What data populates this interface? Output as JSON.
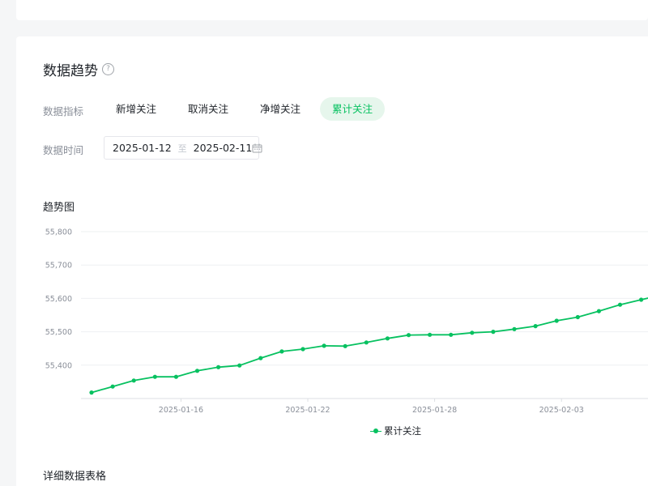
{
  "section": {
    "title": "数据趋势",
    "help_icon": "question-circle-icon"
  },
  "filters": {
    "metric_label": "数据指标",
    "metric_tabs": [
      "新增关注",
      "取消关注",
      "净增关注",
      "累计关注"
    ],
    "active_metric": "累计关注",
    "time_label": "数据时间",
    "date_start": "2025-01-12",
    "date_separator": "至",
    "date_end": "2025-02-11",
    "calendar_icon": "calendar-icon"
  },
  "chart_title": "趋势图",
  "table_title": "详细数据表格",
  "colors": {
    "accent": "#07c160",
    "active_tab_bg": "#e6f6ec"
  },
  "chart_data": {
    "type": "line",
    "x": [
      "2025-01-12",
      "2025-01-13",
      "2025-01-14",
      "2025-01-15",
      "2025-01-16",
      "2025-01-17",
      "2025-01-18",
      "2025-01-19",
      "2025-01-20",
      "2025-01-21",
      "2025-01-22",
      "2025-01-23",
      "2025-01-24",
      "2025-01-25",
      "2025-01-26",
      "2025-01-27",
      "2025-01-28",
      "2025-01-29",
      "2025-01-30",
      "2025-01-31",
      "2025-02-01",
      "2025-02-02",
      "2025-02-03",
      "2025-02-04",
      "2025-02-05",
      "2025-02-06",
      "2025-02-07"
    ],
    "x_ticks": [
      "2025-01-16",
      "2025-01-22",
      "2025-01-28",
      "2025-02-03"
    ],
    "series": [
      {
        "name": "累计关注",
        "values": [
          55318,
          55336,
          55354,
          55365,
          55365,
          55383,
          55394,
          55399,
          55421,
          55441,
          55448,
          55458,
          55457,
          55468,
          55480,
          55490,
          55491,
          55491,
          55497,
          55500,
          55508,
          55517,
          55533,
          55544,
          55562,
          55581,
          55596
        ]
      }
    ],
    "y_ticks": [
      55400,
      55500,
      55600,
      55700,
      55800
    ],
    "y_tick_labels": [
      "55,400",
      "55,500",
      "55,600",
      "55,700",
      "55,800"
    ],
    "ylim": [
      55300,
      55800
    ],
    "grid": true,
    "legend": "bottom-center"
  }
}
